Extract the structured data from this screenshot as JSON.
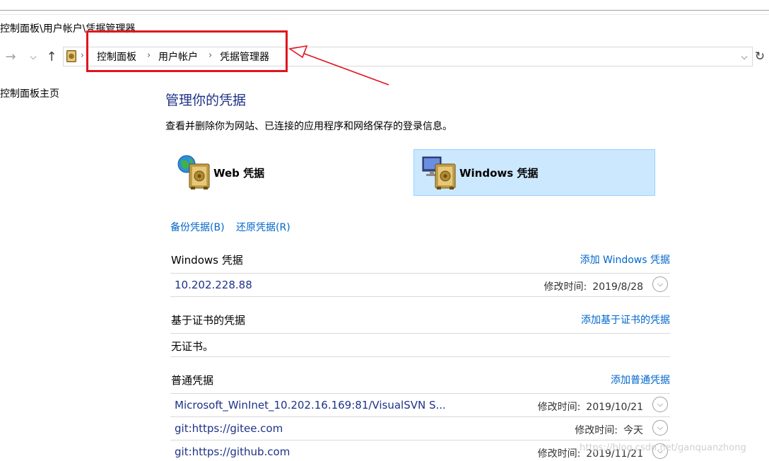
{
  "window": {
    "title_path": "控制面板\\用户帐户\\凭据管理器"
  },
  "nav": {
    "back_glyph": "←",
    "forward_glyph": "→",
    "dropdown_glyph": "⌵",
    "up_glyph": "↑",
    "address_drop_glyph": "⌵",
    "refresh_glyph": "↻"
  },
  "breadcrumb": {
    "items": [
      "控制面板",
      "用户帐户",
      "凭据管理器"
    ],
    "separator": "›"
  },
  "sidebar": {
    "home_link": "控制面板主页"
  },
  "main": {
    "title": "管理你的凭据",
    "description": "查看并删除你为网站、已连接的应用程序和网络保存的登录信息。",
    "tiles": {
      "web": {
        "label": "Web 凭据",
        "icon": "globe-vault-icon"
      },
      "windows": {
        "label": "Windows 凭据",
        "icon": "monitor-vault-icon",
        "selected": true
      }
    },
    "backup_link": "备份凭据(B)",
    "restore_link": "还原凭据(R)",
    "sections": {
      "windows": {
        "title": "Windows 凭据",
        "add": "添加 Windows 凭据",
        "rows": [
          {
            "name": "10.202.228.88",
            "mod_label": "修改时间:",
            "mod_value": "2019/8/28"
          }
        ]
      },
      "cert": {
        "title": "基于证书的凭据",
        "add": "添加基于证书的凭据",
        "empty": "无证书。"
      },
      "generic": {
        "title": "普通凭据",
        "add": "添加普通凭据",
        "rows": [
          {
            "name": "Microsoft_WinInet_10.202.16.169:81/VisualSVN S...",
            "mod_label": "修改时间:",
            "mod_value": "2019/10/21"
          },
          {
            "name": "git:https://gitee.com",
            "mod_label": "修改时间:",
            "mod_value": "今天"
          },
          {
            "name": "git:https://github.com",
            "mod_label": "修改时间:",
            "mod_value": "2019/11/21"
          }
        ]
      }
    },
    "expand_glyph": "⌵"
  },
  "annotation": {
    "highlight_color": "#e0151f"
  },
  "watermark": "https://blog.csdn.net/ganquanzhong",
  "colors": {
    "link": "#0066cc",
    "title": "#1e3287",
    "selected_tile": "#cce8ff"
  }
}
